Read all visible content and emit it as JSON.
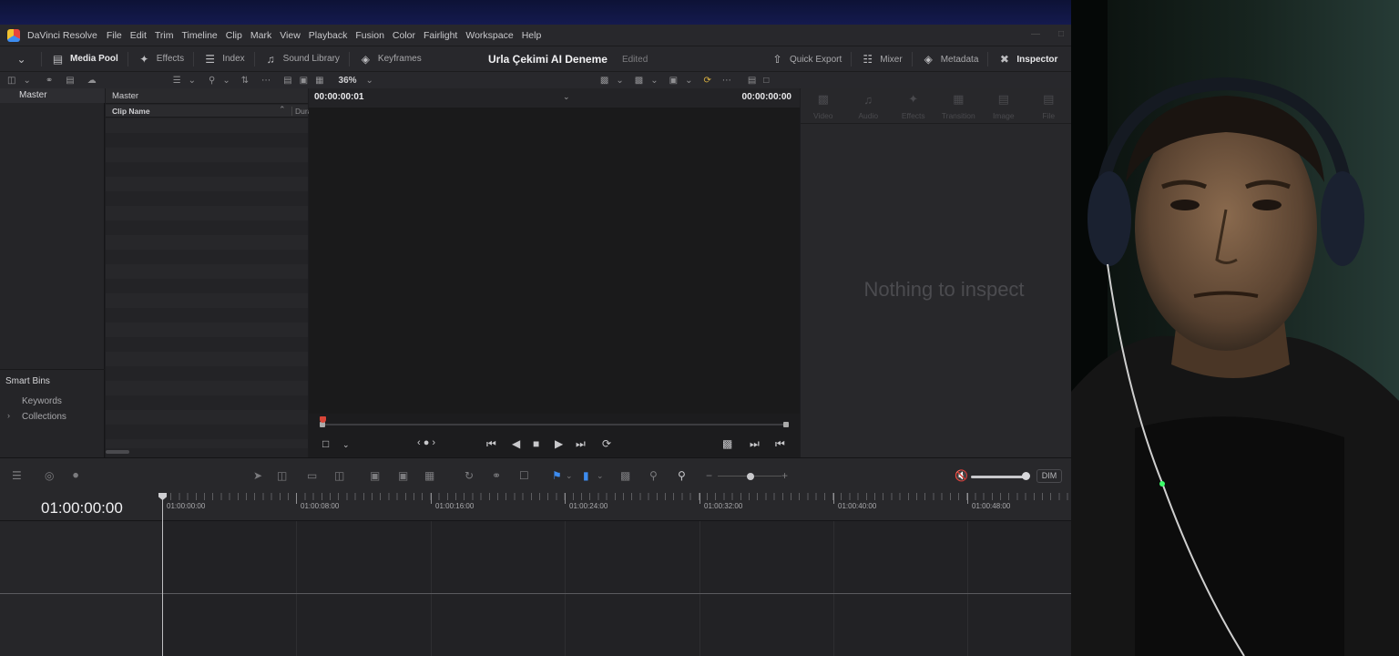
{
  "app": {
    "name": "DaVinci Resolve",
    "menu": [
      "File",
      "Edit",
      "Trim",
      "Timeline",
      "Clip",
      "Mark",
      "View",
      "Playback",
      "Fusion",
      "Color",
      "Fairlight",
      "Workspace",
      "Help"
    ]
  },
  "toolbar": {
    "media_pool": "Media Pool",
    "effects": "Effects",
    "index": "Index",
    "sound_library": "Sound Library",
    "keyframes": "Keyframes",
    "project_title": "Urla Çekimi AI Deneme",
    "project_status": "Edited",
    "quick_export": "Quick Export",
    "mixer": "Mixer",
    "metadata": "Metadata",
    "inspector": "Inspector"
  },
  "subbar": {
    "zoom": "36%"
  },
  "bins": {
    "master": "Master",
    "smart_bins_title": "Smart Bins",
    "keywords": "Keywords",
    "collections": "Collections"
  },
  "media_pool": {
    "header": "Master",
    "column_clip_name": "Clip Name",
    "column_duration": "Dura"
  },
  "viewer": {
    "timecode_left": "00:00:00:01",
    "timecode_right": "00:00:00:00"
  },
  "inspector_panel": {
    "tabs": [
      "Video",
      "Audio",
      "Effects",
      "Transition",
      "Image",
      "File"
    ],
    "empty_message": "Nothing to inspect"
  },
  "timeline": {
    "timecode": "01:00:00:00",
    "ruler_labels": [
      "01:00:00:00",
      "01:00:08:00",
      "01:00:16:00",
      "01:00:24:00",
      "01:00:32:00",
      "01:00:40:00",
      "01:00:48:00"
    ],
    "dim_label": "DIM"
  },
  "colors": {
    "accent_blue": "#3d8cf0",
    "playhead_red": "#d84538",
    "panel_bg": "#28282b"
  }
}
